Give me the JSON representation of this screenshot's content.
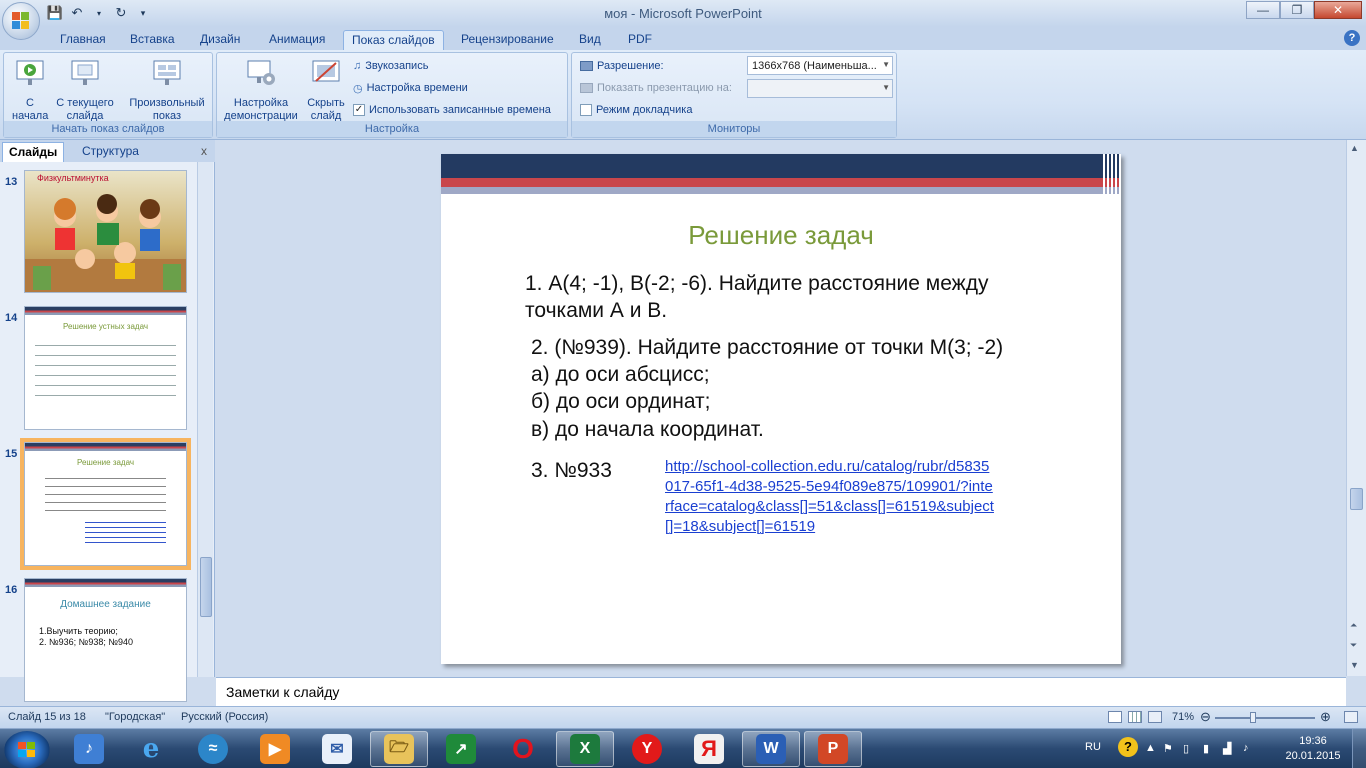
{
  "window": {
    "title": "моя - Microsoft PowerPoint",
    "minimize": "—",
    "maximize": "❐",
    "close": "✕"
  },
  "ribbon_tabs": [
    "Главная",
    "Вставка",
    "Дизайн",
    "Анимация",
    "Показ слайдов",
    "Рецензирование",
    "Вид",
    "PDF"
  ],
  "ribbon": {
    "group1": {
      "title": "Начать показ слайдов",
      "from_beginning": "С начала",
      "from_current": "С текущего слайда",
      "custom_show": "Произвольный показ"
    },
    "group2": {
      "title": "Настройка",
      "setup": "Настройка демонстрации",
      "hide_slide": "Скрыть слайд",
      "record_narration": "Звукозапись",
      "rehearse": "Настройка времени",
      "use_timings": "Использовать записанные времена",
      "use_timings_checked": "✓"
    },
    "group3": {
      "title": "Мониторы",
      "resolution_label": "Разрешение:",
      "resolution_value": "1366x768 (Наименьша...",
      "show_on_label": "Показать презентацию на:",
      "show_on_value": "",
      "presenter_view": "Режим докладчика"
    }
  },
  "panel": {
    "tab_slides": "Слайды",
    "tab_outline": "Структура",
    "close": "x"
  },
  "thumbnails": [
    {
      "num": "13",
      "title": "Физкультминутка"
    },
    {
      "num": "14",
      "title": "Решение устных задач"
    },
    {
      "num": "15",
      "title": "Решение задач"
    },
    {
      "num": "16",
      "title": "Домашнее задание",
      "line1": "1.Выучить теорию;",
      "line2": "2. №936;  №938;  №940"
    }
  ],
  "slide": {
    "title": "Решение задач",
    "line1": "1. А(4; -1),  В(-2; -6). Найдите расстояние между",
    "line2": "точками А и В.",
    "line3": "2. (№939). Найдите расстояние от точки М(3; -2)",
    "line4": "а) до оси абсцисс;",
    "line5": "б) до оси ординат;",
    "line6": "в) до начала координат.",
    "line7": "3. №933",
    "link": "http://school-collection.edu.ru/catalog/rubr/d5835017-65f1-4d38-9525-5e94f089e875/109901/?interface=catalog&class[]=51&class[]=61519&subject[]=18&subject[]=61519"
  },
  "notes_placeholder": "Заметки к слайду",
  "status": {
    "slide_counter": "Слайд 15 из 18",
    "theme": "\"Городская\"",
    "language": "Русский (Россия)",
    "zoom": "71%"
  },
  "taskbar": {
    "lang": "RU",
    "time": "19:36",
    "date": "20.01.2015"
  },
  "colors": {
    "slide_title": "#7a9a3a",
    "link": "#1a3fd1",
    "selected_thumb": "#f7b45f"
  }
}
